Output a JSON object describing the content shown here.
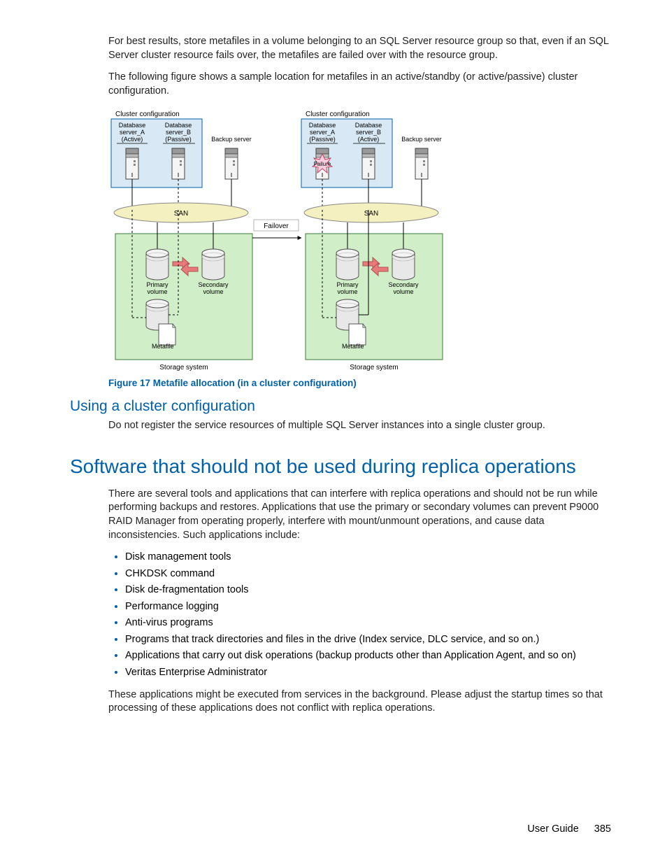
{
  "para1": "For best results, store metafiles in a volume belonging to an SQL Server resource group so that, even if an SQL Server cluster resource fails over, the metafiles are failed over with the resource group.",
  "para2": "The following figure shows a sample location for metafiles in an active/standby (or active/passive) cluster configuration.",
  "figure": {
    "caption": "Figure 17 Metafile allocation (in a cluster configuration)",
    "left": {
      "title": "Cluster configuration",
      "dbA": "Database\nserver_A\n(Active)",
      "dbB": "Database\nserver_B\n(Passive)",
      "backup": "Backup server",
      "san": "SAN",
      "pv": "Primary\nvolume",
      "sv": "Secondary\nvolume",
      "meta": "Metafile",
      "storage": "Storage system"
    },
    "right": {
      "title": "Cluster configuration",
      "dbA": "Database\nserver_A\n(Passive)",
      "dbB": "Database\nserver_B\n(Active)",
      "backup": "Backup server",
      "san": "SAN",
      "pv": "Primary\nvolume",
      "sv": "Secondary\nvolume",
      "meta": "Metafile",
      "storage": "Storage system",
      "failure": "Failure"
    },
    "failover": "Failover"
  },
  "heading_cluster": "Using a cluster configuration",
  "para3": "Do not register the service resources of multiple SQL Server instances into a single cluster group.",
  "heading_software": "Software that should not be used during replica operations",
  "para4": "There are several tools and applications that can interfere with replica operations and should not be run while performing backups and restores. Applications that use the primary or secondary volumes can prevent P9000 RAID Manager from operating properly, interfere with mount/unmount operations, and cause data inconsistencies. Such applications include:",
  "bullets": [
    "Disk management tools",
    "CHKDSK command",
    "Disk de-fragmentation tools",
    "Performance logging",
    "Anti-virus programs",
    "Programs that track directories and files in the drive (Index service, DLC service, and so on.)",
    "Applications that carry out disk operations (backup products other than Application Agent, and so on)",
    "Veritas Enterprise Administrator"
  ],
  "para5": "These applications might be executed from services in the background. Please adjust the startup times so that processing of these applications does not conflict with replica operations.",
  "footer": {
    "title": "User Guide",
    "page": "385"
  }
}
